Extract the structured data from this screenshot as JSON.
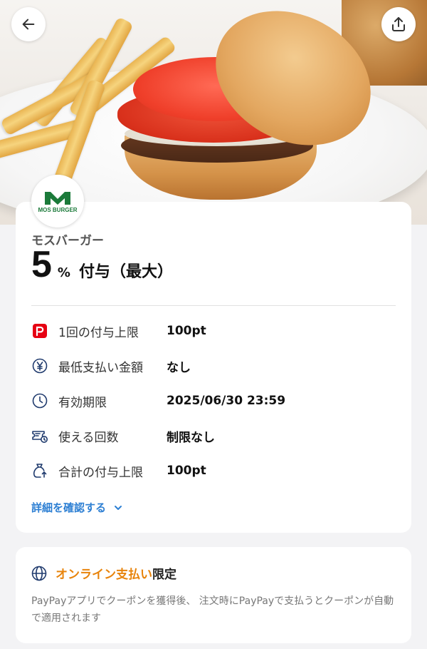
{
  "header": {
    "back_icon": "arrow-left-icon",
    "share_icon": "share-upload-icon"
  },
  "hero": {
    "image": "burger-with-fries-photo"
  },
  "store": {
    "name": "モスバーガー",
    "logo_text": "MOS BURGER",
    "logo_color": "#1b7a3a"
  },
  "offer": {
    "rate_number": "5",
    "rate_unit": "%",
    "rate_label": "付与（最大）"
  },
  "info": [
    {
      "icon": "paypay-icon",
      "label": "1回の付与上限",
      "value": "100pt"
    },
    {
      "icon": "yen-icon",
      "label": "最低支払い金額",
      "value": "なし"
    },
    {
      "icon": "clock-icon",
      "label": "有効期限",
      "value": "2025/06/30 23:59"
    },
    {
      "icon": "ticket-icon",
      "label": "使える回数",
      "value": "制限なし"
    },
    {
      "icon": "money-bag-icon",
      "label": "合計の付与上限",
      "value": "100pt"
    }
  ],
  "details_link": "詳細を確認する",
  "online": {
    "icon": "globe-icon",
    "highlight": "オンライン支払い",
    "rest": "限定",
    "description": "PayPayアプリでクーポンを獲得後、 注文時にPayPayで支払うとクーポンが自動で適用されます"
  },
  "colors": {
    "accent_blue": "#2d7fd3",
    "accent_orange": "#e8840c",
    "paypay_red": "#e60012",
    "icon_navy": "#1f3a6d"
  }
}
